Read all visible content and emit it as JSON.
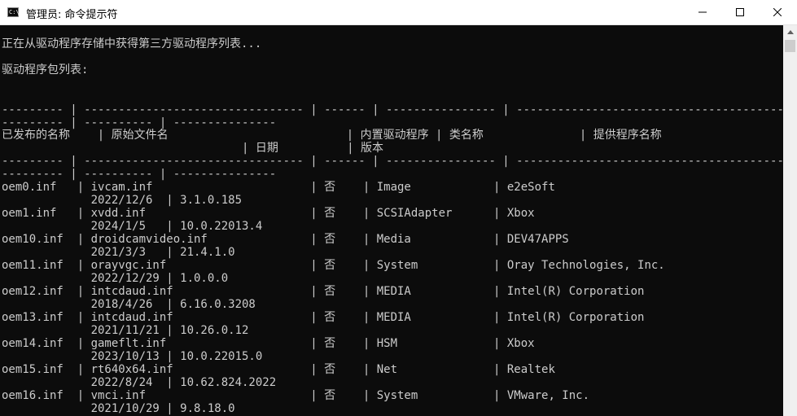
{
  "window": {
    "title": "管理员: 命令提示符",
    "icon_label": "C:\\",
    "minimize_icon": "minimize-icon",
    "maximize_icon": "maximize-icon",
    "close_icon": "close-icon"
  },
  "terminal": {
    "lines": [
      "正在从驱动程序存储中获得第三方驱动程序列表...",
      "",
      "驱动程序包列表:",
      "",
      "",
      "",
      "--------- | -------------------------------- | ------ | ---------------- | ------------------------------------------------------------------",
      "--------- | ---------- | ---------------",
      "已发布的名称    | 原始文件名                          | 内置驱动程序 | 类名称              | 提供程序名称",
      "                                   | 日期          | 版本",
      "--------- | -------------------------------- | ------ | ---------------- | ------------------------------------------------------------------",
      "--------- | ---------- | ---------------",
      "oem0.inf   | ivcam.inf                       | 否    | Image            | e2eSoft",
      "             2022/12/6  | 3.1.0.185",
      "oem1.inf   | xvdd.inf                        | 否    | SCSIAdapter      | Xbox",
      "             2024/1/5   | 10.0.22013.4",
      "oem10.inf  | droidcamvideo.inf               | 否    | Media            | DEV47APPS",
      "             2021/3/3   | 21.4.1.0",
      "oem11.inf  | orayvgc.inf                     | 否    | System           | Oray Technologies, Inc.",
      "             2022/12/29 | 1.0.0.0",
      "oem12.inf  | intcdaud.inf                    | 否    | MEDIA            | Intel(R) Corporation",
      "             2018/4/26  | 6.16.0.3208",
      "oem13.inf  | intcdaud.inf                    | 否    | MEDIA            | Intel(R) Corporation",
      "             2021/11/21 | 10.26.0.12",
      "oem14.inf  | gameflt.inf                     | 否    | HSM              | Xbox",
      "             2023/10/13 | 10.0.22015.0",
      "oem15.inf  | rt640x64.inf                    | 否    | Net              | Realtek",
      "             2022/8/24  | 10.62.824.2022",
      "oem16.inf  | vmci.inf                        | 否    | System           | VMware, Inc.",
      "             2021/10/29 | 9.8.18.0"
    ]
  },
  "scrollbar": {
    "up_icon": "scroll-up-arrow-icon"
  },
  "colors": {
    "background": "#0c0c0c",
    "text": "#cccccc",
    "titlebar": "#ffffff"
  }
}
